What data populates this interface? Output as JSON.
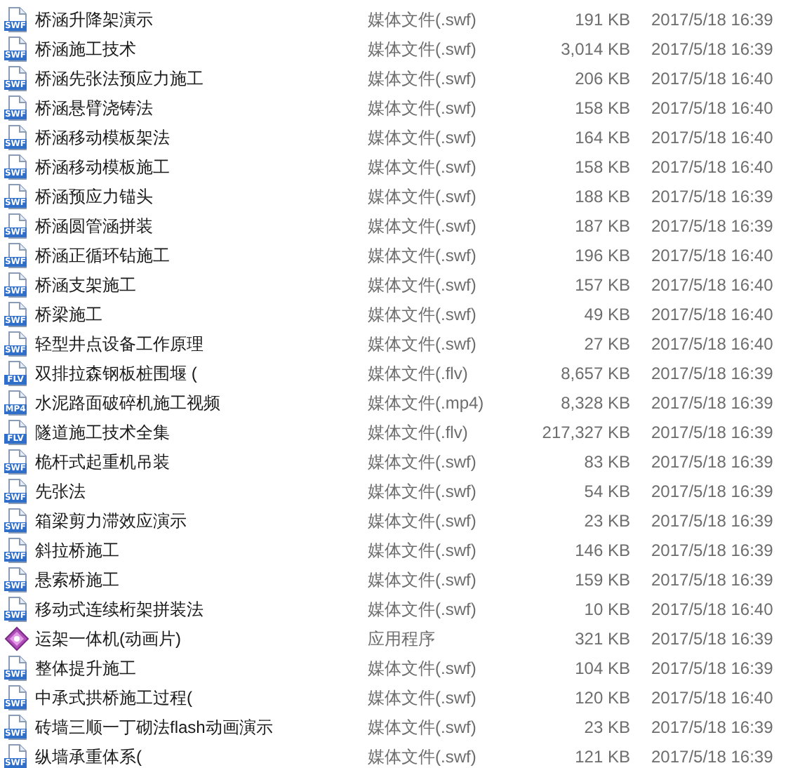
{
  "files": [
    {
      "name": "桥涵升降架演示",
      "kind": "file",
      "icon_text": "SWF",
      "type": "媒体文件(.swf)",
      "size": "191 KB",
      "modified": "2017/5/18 16:39"
    },
    {
      "name": "桥涵施工技术",
      "kind": "file",
      "icon_text": "SWF",
      "type": "媒体文件(.swf)",
      "size": "3,014 KB",
      "modified": "2017/5/18 16:39"
    },
    {
      "name": "桥涵先张法预应力施工",
      "kind": "file",
      "icon_text": "SWF",
      "type": "媒体文件(.swf)",
      "size": "206 KB",
      "modified": "2017/5/18 16:40"
    },
    {
      "name": "桥涵悬臂浇铸法",
      "kind": "file",
      "icon_text": "SWF",
      "type": "媒体文件(.swf)",
      "size": "158 KB",
      "modified": "2017/5/18 16:40"
    },
    {
      "name": "桥涵移动模板架法",
      "kind": "file",
      "icon_text": "SWF",
      "type": "媒体文件(.swf)",
      "size": "164 KB",
      "modified": "2017/5/18 16:40"
    },
    {
      "name": "桥涵移动模板施工",
      "kind": "file",
      "icon_text": "SWF",
      "type": "媒体文件(.swf)",
      "size": "158 KB",
      "modified": "2017/5/18 16:40"
    },
    {
      "name": "桥涵预应力锚头",
      "kind": "file",
      "icon_text": "SWF",
      "type": "媒体文件(.swf)",
      "size": "188 KB",
      "modified": "2017/5/18 16:39"
    },
    {
      "name": "桥涵圆管涵拼装",
      "kind": "file",
      "icon_text": "SWF",
      "type": "媒体文件(.swf)",
      "size": "187 KB",
      "modified": "2017/5/18 16:39"
    },
    {
      "name": "桥涵正循环钻施工",
      "kind": "file",
      "icon_text": "SWF",
      "type": "媒体文件(.swf)",
      "size": "196 KB",
      "modified": "2017/5/18 16:40"
    },
    {
      "name": "桥涵支架施工",
      "kind": "file",
      "icon_text": "SWF",
      "type": "媒体文件(.swf)",
      "size": "157 KB",
      "modified": "2017/5/18 16:40"
    },
    {
      "name": "桥梁施工",
      "kind": "file",
      "icon_text": "SWF",
      "type": "媒体文件(.swf)",
      "size": "49 KB",
      "modified": "2017/5/18 16:40"
    },
    {
      "name": "轻型井点设备工作原理",
      "kind": "file",
      "icon_text": "SWF",
      "type": "媒体文件(.swf)",
      "size": "27 KB",
      "modified": "2017/5/18 16:40"
    },
    {
      "name": "双排拉森钢板桩围堰 (",
      "kind": "file",
      "icon_text": "FLV",
      "type": "媒体文件(.flv)",
      "size": "8,657 KB",
      "modified": "2017/5/18 16:39"
    },
    {
      "name": "水泥路面破碎机施工视频",
      "kind": "file",
      "icon_text": "MP4",
      "type": "媒体文件(.mp4)",
      "size": "8,328 KB",
      "modified": "2017/5/18 16:39"
    },
    {
      "name": "隧道施工技术全集",
      "kind": "file",
      "icon_text": "FLV",
      "type": "媒体文件(.flv)",
      "size": "217,327 KB",
      "modified": "2017/5/18 16:39"
    },
    {
      "name": "桅杆式起重机吊装",
      "kind": "file",
      "icon_text": "SWF",
      "type": "媒体文件(.swf)",
      "size": "83 KB",
      "modified": "2017/5/18 16:39"
    },
    {
      "name": "先张法",
      "kind": "file",
      "icon_text": "SWF",
      "type": "媒体文件(.swf)",
      "size": "54 KB",
      "modified": "2017/5/18 16:39"
    },
    {
      "name": "箱梁剪力滞效应演示",
      "kind": "file",
      "icon_text": "SWF",
      "type": "媒体文件(.swf)",
      "size": "23 KB",
      "modified": "2017/5/18 16:39"
    },
    {
      "name": "斜拉桥施工",
      "kind": "file",
      "icon_text": "SWF",
      "type": "媒体文件(.swf)",
      "size": "146 KB",
      "modified": "2017/5/18 16:39"
    },
    {
      "name": "悬索桥施工",
      "kind": "file",
      "icon_text": "SWF",
      "type": "媒体文件(.swf)",
      "size": "159 KB",
      "modified": "2017/5/18 16:39"
    },
    {
      "name": "移动式连续桁架拼装法",
      "kind": "file",
      "icon_text": "SWF",
      "type": "媒体文件(.swf)",
      "size": "10 KB",
      "modified": "2017/5/18 16:40"
    },
    {
      "name": "运架一体机(动画片)",
      "kind": "app",
      "type": "应用程序",
      "size": "321 KB",
      "modified": "2017/5/18 16:39"
    },
    {
      "name": "整体提升施工",
      "kind": "file",
      "icon_text": "SWF",
      "type": "媒体文件(.swf)",
      "size": "104 KB",
      "modified": "2017/5/18 16:39"
    },
    {
      "name": "中承式拱桥施工过程(",
      "kind": "file",
      "icon_text": "SWF",
      "type": "媒体文件(.swf)",
      "size": "120 KB",
      "modified": "2017/5/18 16:40"
    },
    {
      "name": "砖墙三顺一丁砌法flash动画演示",
      "kind": "file",
      "icon_text": "SWF",
      "type": "媒体文件(.swf)",
      "size": "23 KB",
      "modified": "2017/5/18 16:39"
    },
    {
      "name": "纵墙承重体系(",
      "kind": "file",
      "icon_text": "SWF",
      "type": "媒体文件(.swf)",
      "size": "121 KB",
      "modified": "2017/5/18 16:39"
    }
  ]
}
